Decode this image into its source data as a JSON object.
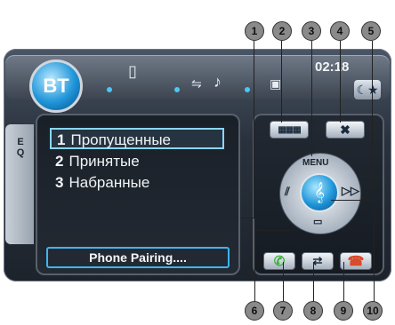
{
  "status_bar": {
    "bt_label": "BT",
    "clock": "02:18",
    "icons": [
      "phone-icon",
      "audio-stream-icon",
      "music-note-icon",
      "contacts-icon"
    ]
  },
  "eq_tab": {
    "label_line1": "E",
    "label_line2": "Q"
  },
  "call_list": {
    "items": [
      {
        "number": "1",
        "label": "Пропущенные",
        "selected": true
      },
      {
        "number": "2",
        "label": "Принятые",
        "selected": false
      },
      {
        "number": "3",
        "label": "Набранные",
        "selected": false
      }
    ],
    "status_text": "Phone Pairing...."
  },
  "controls": {
    "menu_label": "MENU",
    "keypad_icon": "keypad-icon",
    "settings_icon": "tools-icon",
    "night_mode_icon": "night-mode-icon",
    "call_button_color": "#3fae3f",
    "hangup_button_color": "#d94a2b",
    "accent_color": "#1f95d9"
  },
  "callouts": [
    "1",
    "2",
    "3",
    "4",
    "5",
    "6",
    "7",
    "8",
    "9",
    "10"
  ]
}
